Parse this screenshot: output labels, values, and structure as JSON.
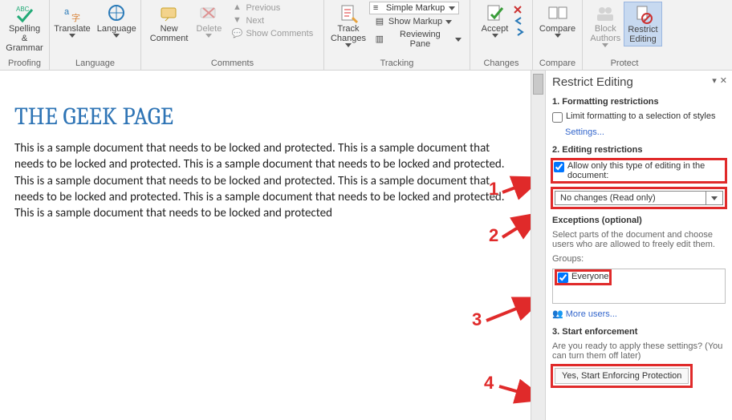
{
  "ribbon": {
    "proofing": {
      "spelling": "Spelling &\nGrammar",
      "title": "Proofing"
    },
    "language": {
      "translate": "Translate",
      "language": "Language",
      "title": "Language"
    },
    "comments": {
      "new": "New\nComment",
      "delete": "Delete",
      "previous": "Previous",
      "next": "Next",
      "show": "Show Comments",
      "title": "Comments"
    },
    "tracking": {
      "track": "Track\nChanges",
      "markup_sel": "Simple Markup",
      "show_markup": "Show Markup",
      "review_pane": "Reviewing Pane",
      "title": "Tracking"
    },
    "changes": {
      "accept": "Accept",
      "title": "Changes"
    },
    "compare": {
      "compare": "Compare",
      "title": "Compare"
    },
    "protect": {
      "block": "Block\nAuthors",
      "restrict": "Restrict\nEditing",
      "title": "Protect"
    }
  },
  "doc": {
    "title": "THE GEEK PAGE",
    "body": "This is a sample document that needs to be locked and protected. This is a sample document that needs to be locked and protected. This is a sample document that needs to be locked and protected. This is a sample document that needs to be locked and protected. This is a sample document that needs to be locked and protected. This is a sample document that needs to be locked and protected. This is a sample document that needs to be locked and protected"
  },
  "pane": {
    "title": "Restrict Editing",
    "s1_h": "1. Formatting restrictions",
    "s1_chk": "Limit formatting to a selection of styles",
    "s1_settings": "Settings...",
    "s2_h": "2. Editing restrictions",
    "s2_chk": "Allow only this type of editing in the document:",
    "s2_sel": "No changes (Read only)",
    "exc_h": "Exceptions (optional)",
    "exc_txt": "Select parts of the document and choose users who are allowed to freely edit them.",
    "groups": "Groups:",
    "everyone": "Everyone",
    "more_users": "More users...",
    "s3_h": "3. Start enforcement",
    "s3_txt": "Are you ready to apply these settings? (You can turn them off later)",
    "enforce_btn": "Yes, Start Enforcing Protection"
  },
  "callouts": {
    "c1": "1",
    "c2": "2",
    "c3": "3",
    "c4": "4"
  }
}
